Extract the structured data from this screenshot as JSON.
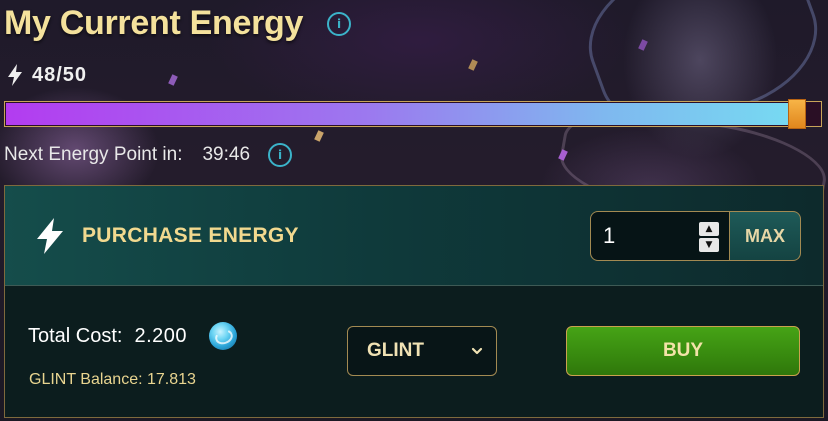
{
  "header": {
    "title": "My Current Energy",
    "info_icon": "info-icon"
  },
  "energy": {
    "icon": "lightning-bolt-icon",
    "count_text": "48/50",
    "current": 48,
    "max": 50,
    "progress_fraction": 0.98,
    "bar_gradient": [
      "#b33cf0",
      "#76dcf2"
    ],
    "knob_color": "#f0a030"
  },
  "next_point": {
    "label": "Next Energy Point in:",
    "timer": "39:46",
    "info_icon": "info-icon"
  },
  "purchase": {
    "title": "PURCHASE ENERGY",
    "icon": "lightning-bolt-icon",
    "quantity_value": "1",
    "max_label": "MAX",
    "total_cost_label": "Total Cost:",
    "total_cost_value": "2.200",
    "token_icon": "glint-token-icon",
    "balance_text": "GLINT Balance: 17.813",
    "currency_selected": "GLINT",
    "buy_label": "BUY"
  },
  "colors": {
    "title": "#f4e19c",
    "accent_teal": "#3bb3c9",
    "buy_green": "#3a8e10",
    "gold_border": "#a38a52"
  }
}
